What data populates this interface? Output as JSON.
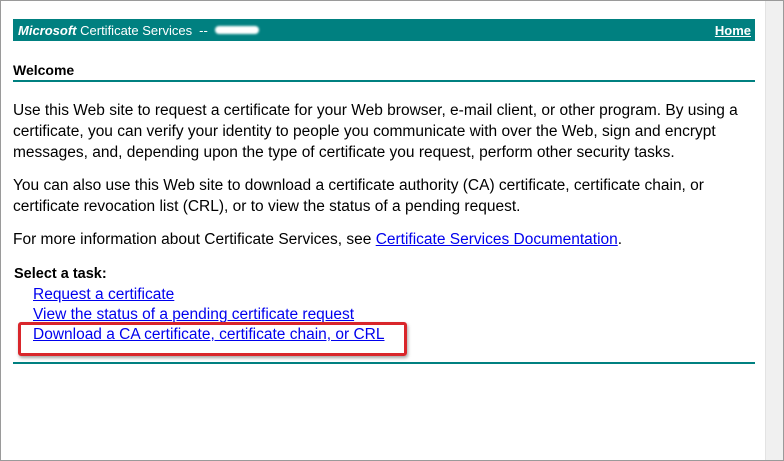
{
  "header": {
    "brand_ms": "Microsoft",
    "brand_rest": "Certificate Services",
    "separator": "--",
    "home_label": "Home"
  },
  "welcome": {
    "title": "Welcome",
    "para1": "Use this Web site to request a certificate for your Web browser, e-mail client, or other program. By using a certificate, you can verify your identity to people you communicate with over the Web, sign and encrypt messages, and, depending upon the type of certificate you request, perform other security tasks.",
    "para2": "You can also use this Web site to download a certificate authority (CA) certificate, certificate chain, or certificate revocation list (CRL), or to view the status of a pending request.",
    "para3_prefix": "For more information about Certificate Services, see ",
    "para3_link": "Certificate Services Documentation",
    "para3_suffix": "."
  },
  "tasks": {
    "heading": "Select a task:",
    "items": [
      {
        "label": "Request a certificate"
      },
      {
        "label": "View the status of a pending certificate request"
      },
      {
        "label": "Download a CA certificate, certificate chain, or CRL"
      }
    ]
  },
  "colors": {
    "header_bg": "#008080",
    "link": "#0000ee",
    "highlight": "#d9262b"
  }
}
